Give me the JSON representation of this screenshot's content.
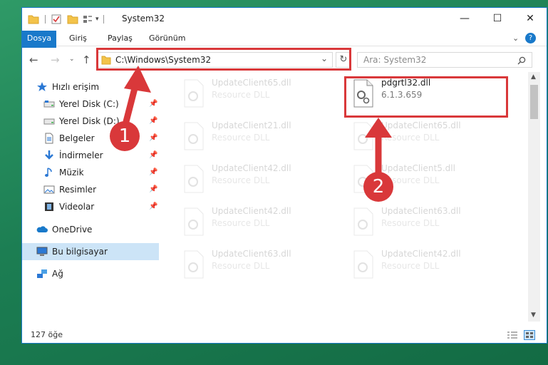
{
  "window": {
    "title": "System32",
    "controls": {
      "minimize": "—",
      "maximize": "☐",
      "close": "✕"
    }
  },
  "ribbon": {
    "tabs": [
      "Dosya",
      "Giriş",
      "Paylaş",
      "Görünüm"
    ]
  },
  "navigation": {
    "address_path": "C:\\Windows\\System32",
    "search_placeholder": "Ara: System32"
  },
  "sidebar": {
    "items": [
      {
        "label": "Hızlı erişim",
        "icon": "star-icon"
      },
      {
        "label": "Yerel Disk (C:)",
        "icon": "drive-icon",
        "pinned": true
      },
      {
        "label": "Yerel Disk (D:)",
        "icon": "drive-icon",
        "pinned": true
      },
      {
        "label": "Belgeler",
        "icon": "documents-icon",
        "pinned": true
      },
      {
        "label": "İndirmeler",
        "icon": "download-icon",
        "pinned": true
      },
      {
        "label": "Müzik",
        "icon": "music-icon",
        "pinned": true
      },
      {
        "label": "Resimler",
        "icon": "pictures-icon",
        "pinned": true
      },
      {
        "label": "Videolar",
        "icon": "video-icon",
        "pinned": true
      },
      {
        "label": "OneDrive",
        "icon": "cloud-icon"
      },
      {
        "label": "Bu bilgisayar",
        "icon": "computer-icon",
        "selected": true
      },
      {
        "label": "Ağ",
        "icon": "network-icon"
      }
    ]
  },
  "files": [
    {
      "name": "UpdateClient65.dll",
      "type": "Resource DLL",
      "faded": true
    },
    {
      "name": "pdgrtl32.dll",
      "type": "6.1.3.659",
      "faded": false
    },
    {
      "name": "UpdateClient21.dll",
      "type": "Resource DLL",
      "faded": true
    },
    {
      "name": "UpdateClient65.dll",
      "type": "Resource DLL",
      "faded": true
    },
    {
      "name": "UpdateClient42.dll",
      "type": "Resource DLL",
      "faded": true
    },
    {
      "name": "UpdateClient5.dll",
      "type": "Resource DLL",
      "faded": true
    },
    {
      "name": "UpdateClient42.dll",
      "type": "Resource DLL",
      "faded": true
    },
    {
      "name": "UpdateClient63.dll",
      "type": "Resource DLL",
      "faded": true
    },
    {
      "name": "UpdateClient63.dll",
      "type": "Resource DLL",
      "faded": true
    },
    {
      "name": "UpdateClient42.dll",
      "type": "Resource DLL",
      "faded": true
    }
  ],
  "status": {
    "item_count": "127 öğe"
  },
  "annotations": {
    "step1": "1",
    "step2": "2",
    "color": "#d9383a"
  }
}
